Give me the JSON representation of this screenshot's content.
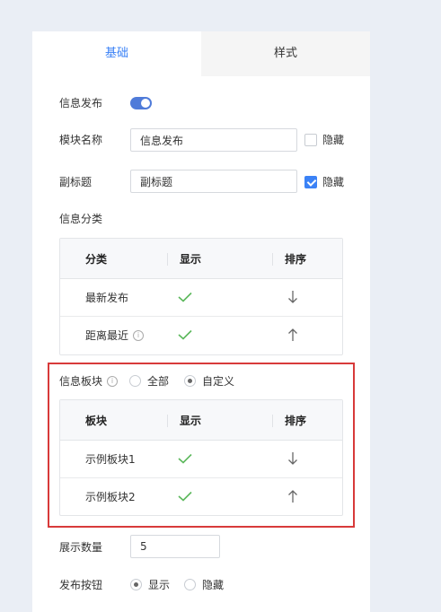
{
  "tabs": {
    "basic": "基础",
    "style": "样式"
  },
  "publish": {
    "label": "信息发布",
    "enabled": true
  },
  "module_name": {
    "label": "模块名称",
    "value": "信息发布",
    "hide_label": "隐藏",
    "hidden": false
  },
  "subtitle": {
    "label": "副标题",
    "value": "副标题",
    "hide_label": "隐藏",
    "hidden": true
  },
  "category": {
    "label": "信息分类",
    "headers": [
      "分类",
      "显示",
      "排序"
    ],
    "rows": [
      {
        "name": "最新发布",
        "sort": "down"
      },
      {
        "name": "距离最近",
        "sort": "up",
        "info": true
      }
    ]
  },
  "blocks": {
    "label": "信息板块",
    "option_all": "全部",
    "option_custom": "自定义",
    "selected": "custom",
    "headers": [
      "板块",
      "显示",
      "排序"
    ],
    "rows": [
      {
        "name": "示例板块1",
        "sort": "down"
      },
      {
        "name": "示例板块2",
        "sort": "up"
      }
    ]
  },
  "display_count": {
    "label": "展示数量",
    "value": "5"
  },
  "publish_button": {
    "label": "发布按钮",
    "option_show": "显示",
    "option_hide": "隐藏",
    "selected": "show"
  },
  "colors": {
    "accent": "#3b82f6",
    "toggle": "#4f7bd9",
    "check": "#5cb85c",
    "highlight": "#d83a3a"
  }
}
